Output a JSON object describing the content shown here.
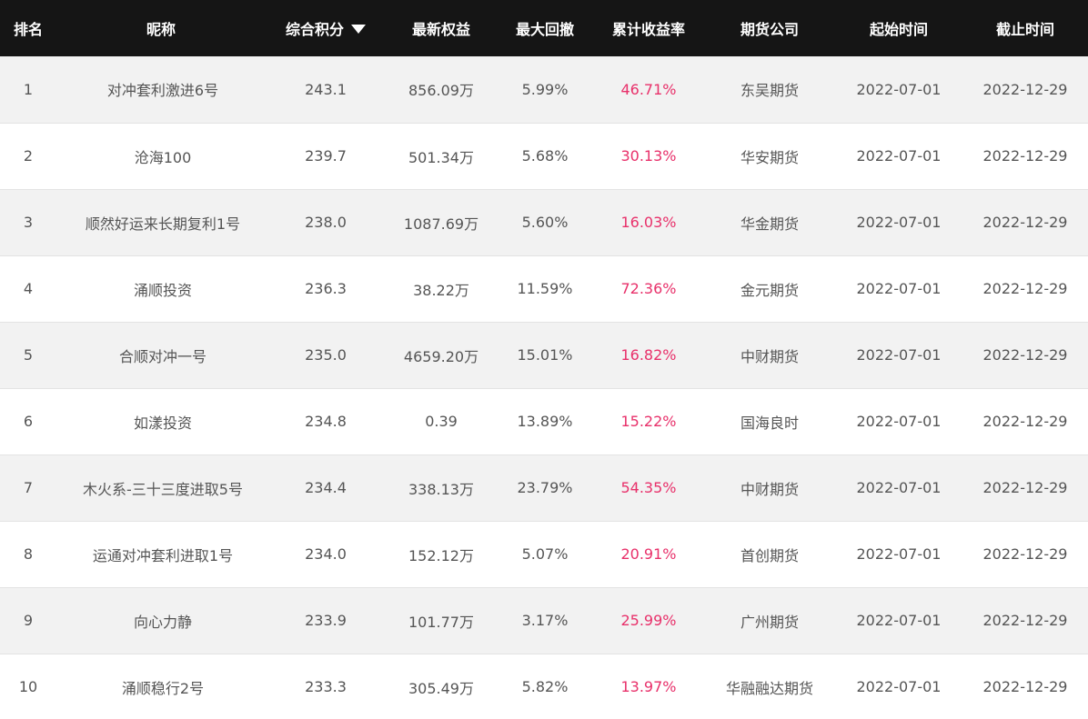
{
  "table": {
    "headers": {
      "rank": "排名",
      "nickname": "昵称",
      "score": "综合积分",
      "equity": "最新权益",
      "drawdown": "最大回撤",
      "return": "累计收益率",
      "company": "期货公司",
      "start": "起始时间",
      "end": "截止时间"
    },
    "sort": {
      "column": "score",
      "direction": "desc",
      "icon": "triangle-down-icon"
    },
    "colors": {
      "header_bg": "#151515",
      "return_text": "#e8306a",
      "row_stripe": "#f2f2f2"
    },
    "rows": [
      {
        "rank": "1",
        "nickname": "对冲套利激进6号",
        "score": "243.1",
        "equity": "856.09万",
        "drawdown": "5.99%",
        "return": "46.71%",
        "company": "东吴期货",
        "start": "2022-07-01",
        "end": "2022-12-29"
      },
      {
        "rank": "2",
        "nickname": "沧海100",
        "score": "239.7",
        "equity": "501.34万",
        "drawdown": "5.68%",
        "return": "30.13%",
        "company": "华安期货",
        "start": "2022-07-01",
        "end": "2022-12-29"
      },
      {
        "rank": "3",
        "nickname": "顺然好运来长期复利1号",
        "score": "238.0",
        "equity": "1087.69万",
        "drawdown": "5.60%",
        "return": "16.03%",
        "company": "华金期货",
        "start": "2022-07-01",
        "end": "2022-12-29"
      },
      {
        "rank": "4",
        "nickname": "涌顺投资",
        "score": "236.3",
        "equity": "38.22万",
        "drawdown": "11.59%",
        "return": "72.36%",
        "company": "金元期货",
        "start": "2022-07-01",
        "end": "2022-12-29"
      },
      {
        "rank": "5",
        "nickname": "合顺对冲一号",
        "score": "235.0",
        "equity": "4659.20万",
        "drawdown": "15.01%",
        "return": "16.82%",
        "company": "中财期货",
        "start": "2022-07-01",
        "end": "2022-12-29"
      },
      {
        "rank": "6",
        "nickname": "如漾投资",
        "score": "234.8",
        "equity": "0.39",
        "drawdown": "13.89%",
        "return": "15.22%",
        "company": "国海良时",
        "start": "2022-07-01",
        "end": "2022-12-29"
      },
      {
        "rank": "7",
        "nickname": "木火系-三十三度进取5号",
        "score": "234.4",
        "equity": "338.13万",
        "drawdown": "23.79%",
        "return": "54.35%",
        "company": "中财期货",
        "start": "2022-07-01",
        "end": "2022-12-29"
      },
      {
        "rank": "8",
        "nickname": "运通对冲套利进取1号",
        "score": "234.0",
        "equity": "152.12万",
        "drawdown": "5.07%",
        "return": "20.91%",
        "company": "首创期货",
        "start": "2022-07-01",
        "end": "2022-12-29"
      },
      {
        "rank": "9",
        "nickname": "向心力静",
        "score": "233.9",
        "equity": "101.77万",
        "drawdown": "3.17%",
        "return": "25.99%",
        "company": "广州期货",
        "start": "2022-07-01",
        "end": "2022-12-29"
      },
      {
        "rank": "10",
        "nickname": "涌顺稳行2号",
        "score": "233.3",
        "equity": "305.49万",
        "drawdown": "5.82%",
        "return": "13.97%",
        "company": "华融融达期货",
        "start": "2022-07-01",
        "end": "2022-12-29"
      }
    ]
  }
}
